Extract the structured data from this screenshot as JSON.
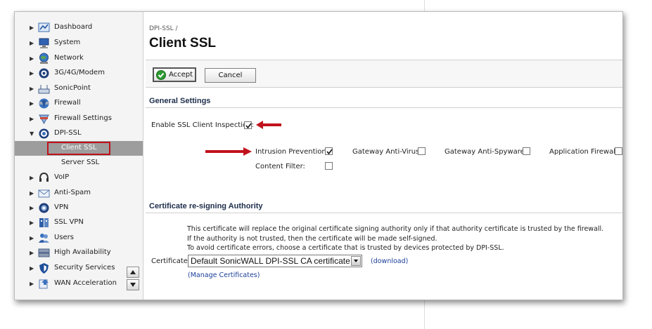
{
  "sidebar": {
    "items": [
      {
        "label": "Dashboard",
        "icon": "dashboard-icon"
      },
      {
        "label": "System",
        "icon": "system-monitor-icon"
      },
      {
        "label": "Network",
        "icon": "network-globe-icon"
      },
      {
        "label": "3G/4G/Modem",
        "icon": "modem-icon"
      },
      {
        "label": "SonicPoint",
        "icon": "access-point-icon"
      },
      {
        "label": "Firewall",
        "icon": "firewall-icon"
      },
      {
        "label": "Firewall Settings",
        "icon": "firewall-settings-icon"
      },
      {
        "label": "DPI-SSL",
        "icon": "dpi-ssl-icon"
      },
      {
        "label": "VoIP",
        "icon": "voip-headset-icon"
      },
      {
        "label": "Anti-Spam",
        "icon": "anti-spam-icon"
      },
      {
        "label": "VPN",
        "icon": "vpn-icon"
      },
      {
        "label": "SSL VPN",
        "icon": "ssl-vpn-icon"
      },
      {
        "label": "Users",
        "icon": "users-icon"
      },
      {
        "label": "High Availability",
        "icon": "high-availability-icon"
      },
      {
        "label": "Security Services",
        "icon": "security-shield-icon"
      },
      {
        "label": "WAN Acceleration",
        "icon": "wan-acceleration-icon"
      }
    ],
    "subitems": [
      {
        "label": "Client SSL",
        "active": true
      },
      {
        "label": "Server SSL",
        "active": false
      }
    ]
  },
  "breadcrumb": "DPI-SSL /",
  "page_title": "Client SSL",
  "toolbar": {
    "accept_label": "Accept",
    "cancel_label": "Cancel"
  },
  "general": {
    "heading": "General Settings",
    "enable_label": "Enable SSL Client Inspection:",
    "enable_checked": true,
    "options": [
      {
        "label": "Intrusion Prevention:",
        "checked": true
      },
      {
        "label": "Gateway Anti-Virus:",
        "checked": false
      },
      {
        "label": "Gateway Anti-Spyware:",
        "checked": false
      },
      {
        "label": "Application Firewall:",
        "checked": false
      },
      {
        "label": "Content Filter:",
        "checked": false
      }
    ]
  },
  "cert": {
    "heading": "Certificate re-signing Authority",
    "notes": [
      "This certificate will replace the original certificate signing authority only if that authority certificate is trusted by the firewall.",
      "If the authority is not trusted, then the certificate will be made self-signed.",
      "To avoid certificate errors, choose a certificate that is trusted by devices protected by DPI-SSL."
    ],
    "label": "Certificate:",
    "selected": "Default SonicWALL DPI-SSL CA certificate",
    "download_link": "(download)",
    "manage_link": "(Manage Certificates)"
  },
  "colors": {
    "highlight_red": "#c0121c",
    "active_nav": "#9d9d9d",
    "link": "#1b3f99"
  }
}
